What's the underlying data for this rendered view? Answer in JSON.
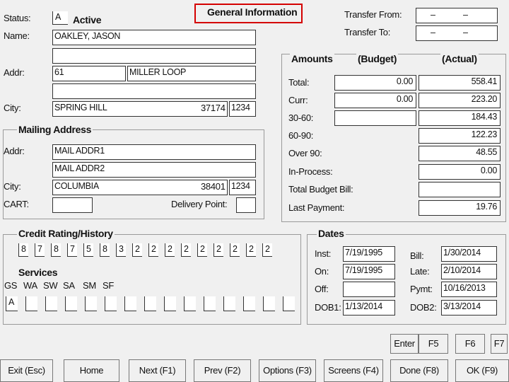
{
  "title": "General Information",
  "status": {
    "label": "Status:",
    "value": "A",
    "text": "Active"
  },
  "name": {
    "label": "Name:",
    "value": "OAKLEY, JASON",
    "line2": ""
  },
  "addr": {
    "label": "Addr:",
    "number": "61",
    "street": "MILLER LOOP",
    "line2": ""
  },
  "city": {
    "label": "City:",
    "value": "SPRING HILL",
    "zip": "37174",
    "zip4": "1234"
  },
  "transfer": {
    "from_label": "Transfer From:",
    "to_label": "Transfer To:",
    "from_a": "–",
    "from_b": "–",
    "to_a": "–",
    "to_b": "–"
  },
  "mailing": {
    "header": "Mailing Address",
    "addr_label": "Addr:",
    "addr1": "MAIL ADDR1",
    "addr2": "MAIL ADDR2",
    "city_label": "City:",
    "city": "COLUMBIA",
    "zip": "38401",
    "zip4": "1234",
    "cart_label": "CART:",
    "cart": "",
    "delivery_label": "Delivery Point:",
    "delivery": ""
  },
  "amounts": {
    "header": "Amounts",
    "budget_header": "(Budget)",
    "actual_header": "(Actual)",
    "rows": [
      {
        "label": "Total:",
        "budget": "0.00",
        "actual": "558.41"
      },
      {
        "label": "Curr:",
        "budget": "0.00",
        "actual": "223.20"
      },
      {
        "label": "30-60:",
        "budget": "",
        "actual": "184.43"
      },
      {
        "label": "60-90:",
        "budget": "",
        "actual": "122.23"
      },
      {
        "label": "Over 90:",
        "budget": "",
        "actual": "48.55"
      },
      {
        "label": "In-Process:",
        "budget": "",
        "actual": "0.00"
      },
      {
        "label": "Total Budget Bill:",
        "budget": "",
        "actual": ""
      },
      {
        "label": "Last Payment:",
        "budget": "",
        "actual": "19.76"
      }
    ]
  },
  "credit": {
    "header": "Credit Rating/History",
    "values": [
      "8",
      "7",
      "8",
      "7",
      "5",
      "8",
      "3",
      "2",
      "2",
      "2",
      "2",
      "2",
      "2",
      "2",
      "2",
      "2"
    ]
  },
  "services": {
    "header": "Services",
    "codes": [
      "GS",
      "WA",
      "SW",
      "SA",
      "SM",
      "SF"
    ],
    "values": [
      "A",
      "",
      "",
      "",
      "",
      "",
      "",
      "",
      "",
      "",
      "",
      "",
      "",
      "",
      ""
    ]
  },
  "dates": {
    "header": "Dates",
    "inst_label": "Inst:",
    "inst": "7/19/1995",
    "on_label": "On:",
    "on": "7/19/1995",
    "off_label": "Off:",
    "off": "",
    "dob1_label": "DOB1:",
    "dob1": "1/13/2014",
    "bill_label": "Bill:",
    "bill": "1/30/2014",
    "late_label": "Late:",
    "late": "2/10/2014",
    "pymt_label": "Pymt:",
    "pymt": "10/16/2013",
    "dob2_label": "DOB2:",
    "dob2": "3/13/2014"
  },
  "small_buttons": [
    "Enter",
    "F5",
    "F6",
    "F7"
  ],
  "buttons": [
    "Exit (Esc)",
    "Home",
    "Next (F1)",
    "Prev (F2)",
    "Options (F3)",
    "Screens (F4)",
    "Done (F8)",
    "OK (F9)"
  ]
}
